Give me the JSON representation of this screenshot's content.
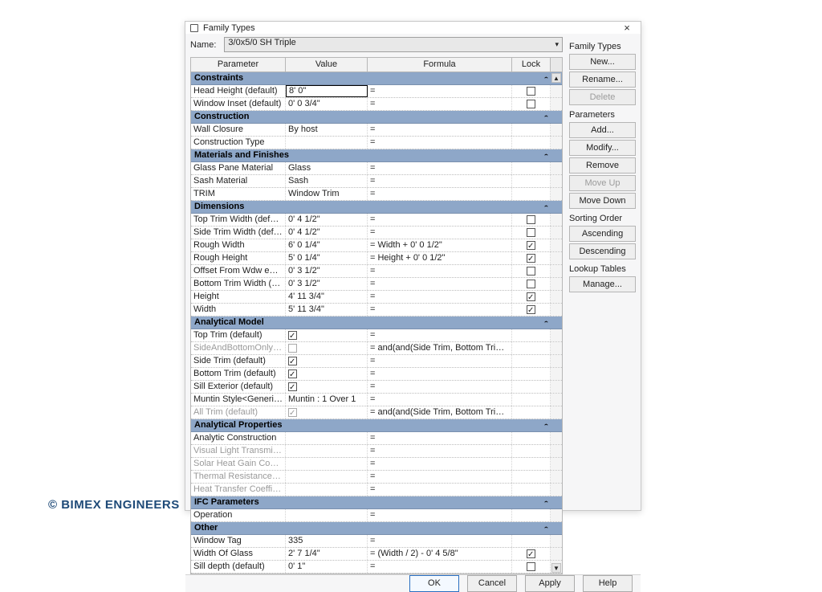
{
  "watermark": "© BIMEX ENGINEERS",
  "dialog": {
    "title": "Family Types",
    "name_label": "Name:",
    "type_name": "3/0x5/0 SH Triple",
    "columns": {
      "param": "Parameter",
      "value": "Value",
      "formula": "Formula",
      "lock": "Lock"
    },
    "footer": {
      "ok": "OK",
      "cancel": "Cancel",
      "apply": "Apply",
      "help": "Help"
    }
  },
  "side": {
    "group_family_types": "Family Types",
    "btn_new": "New...",
    "btn_rename": "Rename...",
    "btn_delete": "Delete",
    "group_parameters": "Parameters",
    "btn_add": "Add...",
    "btn_modify": "Modify...",
    "btn_remove": "Remove",
    "btn_moveup": "Move Up",
    "btn_movedown": "Move Down",
    "group_sorting": "Sorting Order",
    "btn_asc": "Ascending",
    "btn_desc": "Descending",
    "group_lookup": "Lookup Tables",
    "btn_manage": "Manage..."
  },
  "groups": [
    {
      "name": "Constraints",
      "rows": [
        {
          "param": "Head Height (default)",
          "value": "8'  0\"",
          "formula": "=",
          "lock": "unchecked",
          "editing": true
        },
        {
          "param": "Window Inset (default)",
          "value": "0'  0 3/4\"",
          "formula": "=",
          "lock": "unchecked"
        }
      ]
    },
    {
      "name": "Construction",
      "rows": [
        {
          "param": "Wall Closure",
          "value": "By host",
          "formula": "=",
          "lock": null
        },
        {
          "param": "Construction Type",
          "value": "",
          "formula": "=",
          "lock": null
        }
      ]
    },
    {
      "name": "Materials and Finishes",
      "rows": [
        {
          "param": "Glass Pane Material",
          "value": "Glass",
          "formula": "=",
          "lock": null
        },
        {
          "param": "Sash Material",
          "value": "Sash",
          "formula": "=",
          "lock": null
        },
        {
          "param": "TRIM",
          "value": "Window Trim",
          "formula": "=",
          "lock": null
        }
      ]
    },
    {
      "name": "Dimensions",
      "rows": [
        {
          "param": "Top Trim Width (default)",
          "value": "0'  4 1/2\"",
          "formula": "=",
          "lock": "unchecked"
        },
        {
          "param": "Side Trim Width (default)",
          "value": "0'  4 1/2\"",
          "formula": "=",
          "lock": "unchecked"
        },
        {
          "param": "Rough Width",
          "value": "6'  0 1/4\"",
          "formula": "= Width + 0'  0 1/2\"",
          "lock": "checked"
        },
        {
          "param": "Rough Height",
          "value": "5'  0 1/4\"",
          "formula": "= Height + 0'  0 1/2\"",
          "lock": "checked"
        },
        {
          "param": "Offset From Wdw edge (default)",
          "value": "0'  3 1/2\"",
          "formula": "=",
          "lock": "unchecked"
        },
        {
          "param": "Bottom Trim Width (default)",
          "value": "0'  3 1/2\"",
          "formula": "=",
          "lock": "unchecked"
        },
        {
          "param": "Height",
          "value": "4'  11 3/4\"",
          "formula": "=",
          "lock": "checked"
        },
        {
          "param": "Width",
          "value": "5'  11 3/4\"",
          "formula": "=",
          "lock": "checked"
        }
      ]
    },
    {
      "name": "Analytical Model",
      "rows": [
        {
          "param": "Top Trim (default)",
          "value_check": "checked",
          "formula": "=",
          "lock": null
        },
        {
          "param": "SideAndBottomOnly (default)",
          "value_check": "unchecked",
          "formula": "= and(and(Side Trim, Bottom Trim), n",
          "lock": null,
          "dim": true
        },
        {
          "param": "Side Trim (default)",
          "value_check": "checked",
          "formula": "=",
          "lock": null
        },
        {
          "param": "Bottom Trim (default)",
          "value_check": "checked",
          "formula": "=",
          "lock": null
        },
        {
          "param": "Sill Exterior (default)",
          "value_check": "checked",
          "formula": "=",
          "lock": null
        },
        {
          "param": "Muntin Style<Generic Models> (def",
          "value": "Muntin : 1 Over 1",
          "formula": "=",
          "lock": null
        },
        {
          "param": "All Trim (default)",
          "value_check": "checked_dim",
          "formula": "= and(and(Side Trim, Bottom Trim), T",
          "lock": null,
          "dim": true
        }
      ]
    },
    {
      "name": "Analytical Properties",
      "rows": [
        {
          "param": "Analytic Construction",
          "value": "",
          "formula": "=",
          "lock": null
        },
        {
          "param": "Visual Light Transmittance",
          "value": "",
          "formula": "=",
          "lock": null,
          "dim": true
        },
        {
          "param": "Solar Heat Gain Coefficient",
          "value": "",
          "formula": "=",
          "lock": null,
          "dim": true
        },
        {
          "param": "Thermal Resistance (R)",
          "value": "",
          "formula": "=",
          "lock": null,
          "dim": true
        },
        {
          "param": "Heat Transfer Coefficient (U)",
          "value": "",
          "formula": "=",
          "lock": null,
          "dim": true
        }
      ]
    },
    {
      "name": "IFC Parameters",
      "rows": [
        {
          "param": "Operation",
          "value": "",
          "formula": "=",
          "lock": null
        }
      ]
    },
    {
      "name": "Other",
      "rows": [
        {
          "param": "Window Tag",
          "value": "335",
          "formula": "=",
          "lock": null
        },
        {
          "param": "Width Of Glass",
          "value": "2'  7 1/4\"",
          "formula": "= (Width / 2) - 0'  4 5/8\"",
          "lock": "checked"
        },
        {
          "param": "Sill depth (default)",
          "value": "0'  1\"",
          "formula": "=",
          "lock": "unchecked"
        }
      ]
    }
  ]
}
